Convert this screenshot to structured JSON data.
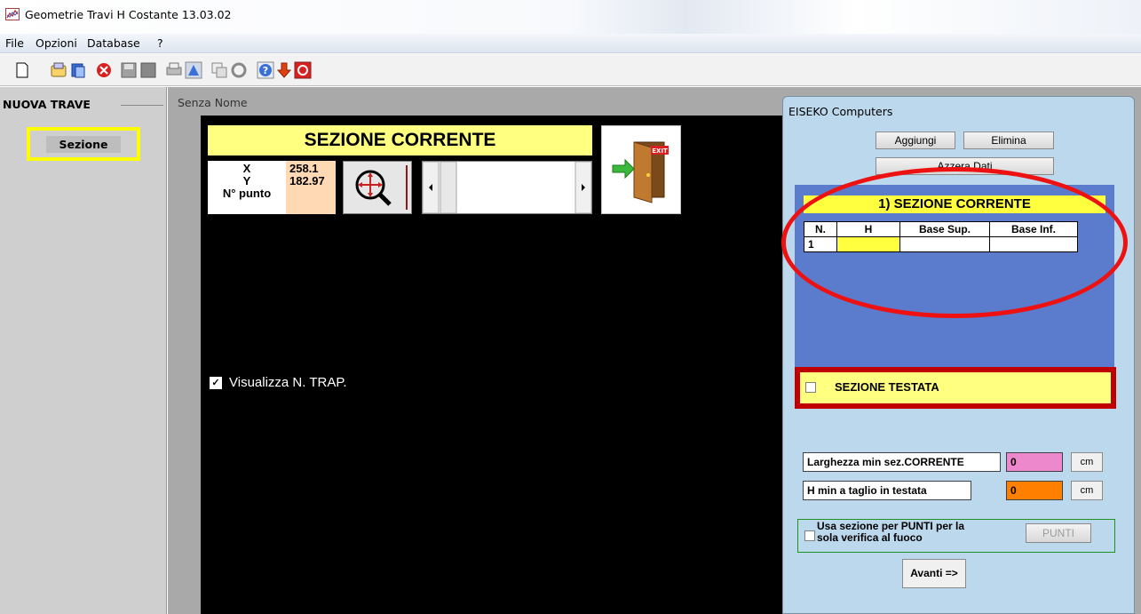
{
  "window": {
    "title": "Geometrie Travi H Costante  13.03.02",
    "app_icon": "chart-app-icon"
  },
  "menu": [
    "File",
    "Opzioni",
    "Database",
    "?"
  ],
  "toolbar": [
    "new-file-icon",
    "open-folder-icon",
    "copy-icon",
    "delete-red-icon",
    "save-icon",
    "save-all-icon",
    "print-icon",
    "triangle-icon",
    "copy-section-icon",
    "refresh-icon",
    "help-icon",
    "down-arrow-icon",
    "power-icon"
  ],
  "left_panel": {
    "header": "NUOVA TRAVE",
    "sezione_button": "Sezione"
  },
  "document": {
    "title": "Senza Nome",
    "banner": "SEZIONE CORRENTE",
    "coords": {
      "x_label": "X",
      "x_value": "258.1",
      "y_label": "Y",
      "y_value": "182.97",
      "point_label": "N° punto"
    },
    "visualizza_checkbox": {
      "label": "Visualizza N. TRAP.",
      "checked": true
    }
  },
  "right_panel": {
    "title": "EISEKO Computers",
    "buttons": {
      "aggiungi": "Aggiungi",
      "elimina": "Elimina",
      "azzera": "Azzera Dati"
    },
    "section_title": "1) SEZIONE CORRENTE",
    "table": {
      "headers": [
        "N.",
        "H",
        "Base Sup.",
        "Base Inf."
      ],
      "rows": [
        [
          "1",
          "",
          "",
          ""
        ]
      ]
    },
    "testata": {
      "label": "SEZIONE TESTATA",
      "checked": false
    },
    "larghezza": {
      "label": "Larghezza min sez.CORRENTE",
      "value": "0",
      "unit": "cm",
      "color": "#ee88cc"
    },
    "h_min": {
      "label": "H min a taglio in testata",
      "value": "0",
      "unit": "cm",
      "color": "#ff8000"
    },
    "punti": {
      "label_line1": "Usa sezione per PUNTI per la",
      "label_line2": "sola verifica al fuoco",
      "button": "PUNTI",
      "checked": false
    },
    "avanti": "Avanti =>"
  },
  "colors": {
    "banner_yellow": "#ffff80",
    "highlight_yellow": "#ffff00",
    "ellipse_red": "#ee1111",
    "testata_border": "#c00000",
    "panel_blue": "#5b7bcd"
  }
}
